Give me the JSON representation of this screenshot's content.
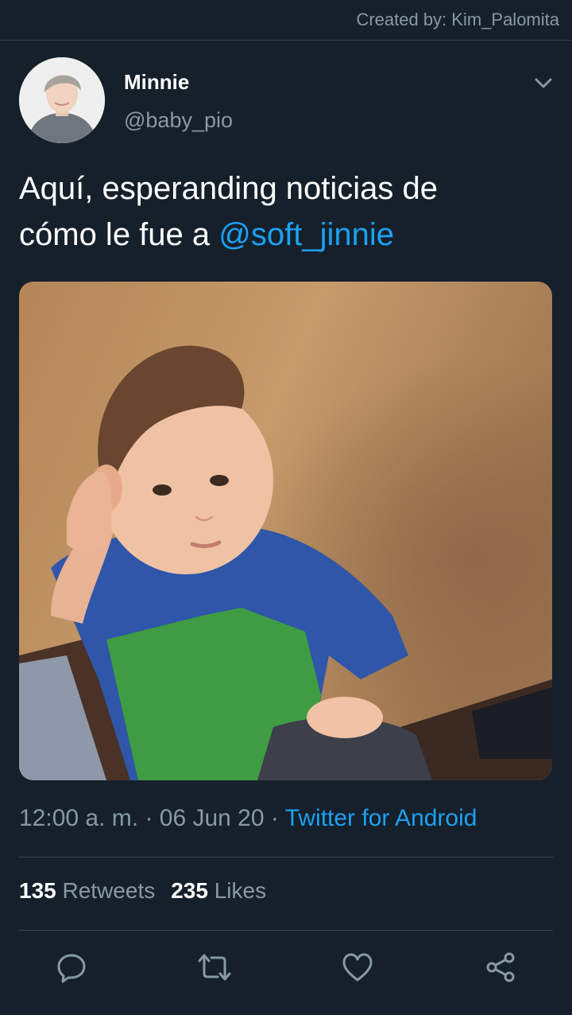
{
  "watermark": "Created by: Kim_Palomita",
  "tweet": {
    "display_name": "Minnie",
    "handle": "@baby_pio",
    "text_line1": "Aquí, esperanding noticias de",
    "text_line2_prefix": "cómo le fue a ",
    "mention": "@soft_jinnie",
    "time": "12:00 a. m.",
    "date": "06 Jun 20",
    "source": "Twitter for Android",
    "retweets_count": "135",
    "retweets_label": "Retweets",
    "likes_count": "235",
    "likes_label": "Likes"
  },
  "icons": {
    "more": "chevron-down-icon",
    "reply": "reply-icon",
    "retweet": "retweet-icon",
    "like": "heart-icon",
    "share": "share-icon"
  },
  "colors": {
    "background": "#15202b",
    "accent": "#1da1f2",
    "muted": "#8899a6",
    "divider": "#38444d"
  }
}
